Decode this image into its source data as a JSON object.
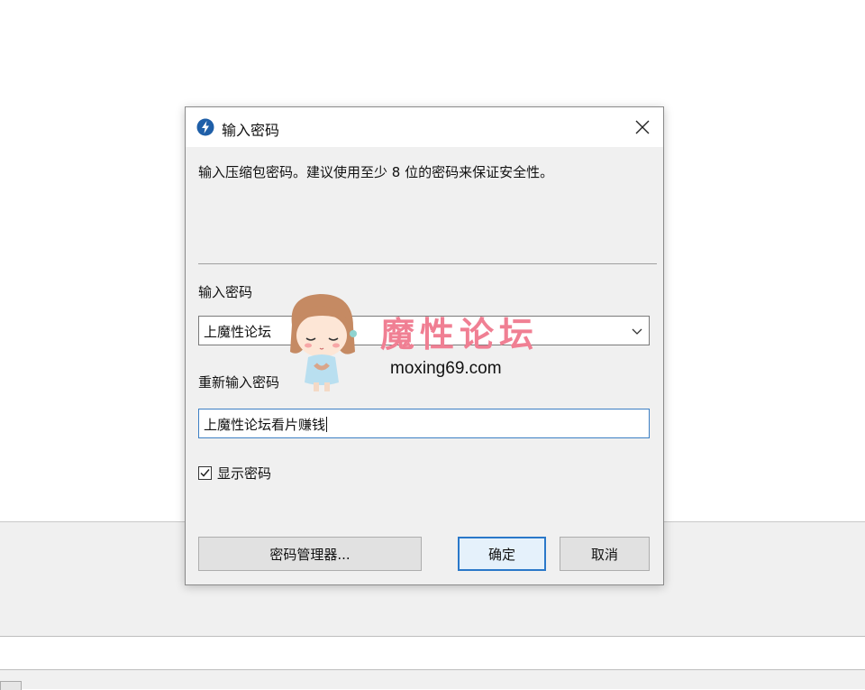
{
  "dialog": {
    "title": "输入密码",
    "description": "输入压缩包密码。建议使用至少 8 位的密码来保证安全性。",
    "password_label": "输入密码",
    "password_value": "上魔性论坛",
    "reenter_label": "重新输入密码",
    "reenter_value": "上魔性论坛看片赚钱",
    "show_password_label": "显示密码",
    "show_password_checked": true,
    "buttons": {
      "manager": "密码管理器...",
      "ok": "确定",
      "cancel": "取消"
    }
  },
  "watermark": {
    "title": "魔性论坛",
    "url": "moxing69.com"
  },
  "colors": {
    "accent": "#2a78c9",
    "watermark_pink": "#f07f93",
    "app_icon_blue": "#1f5fa8"
  },
  "icons": [
    "app-icon",
    "close-icon",
    "chevron-down-icon",
    "checkmark-icon"
  ]
}
